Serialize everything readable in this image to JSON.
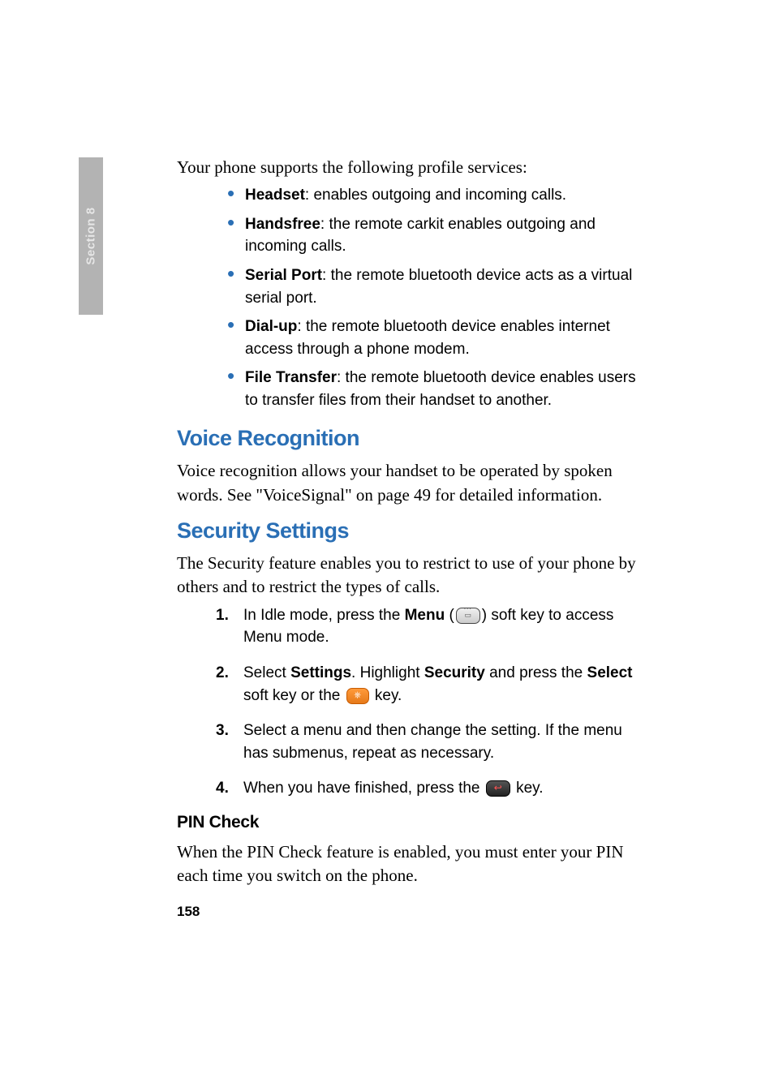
{
  "sideTab": "Section 8",
  "introProfiles": "Your phone supports the following profile services:",
  "profiles": [
    {
      "term": "Headset",
      "desc": ": enables outgoing and incoming calls."
    },
    {
      "term": "Handsfree",
      "desc": ": the remote carkit enables outgoing and incoming calls."
    },
    {
      "term": "Serial Port",
      "desc": ": the remote bluetooth device acts as a virtual serial port."
    },
    {
      "term": "Dial-up",
      "desc": ": the remote bluetooth device enables internet access through a phone modem."
    },
    {
      "term": "File Transfer",
      "desc": ": the remote bluetooth device enables users to transfer files from their handset to another."
    }
  ],
  "voiceRecognition": {
    "heading": "Voice Recognition",
    "body": "Voice recognition allows your handset to be operated by spoken words. See \"VoiceSignal\" on page 49 for detailed information."
  },
  "securitySettings": {
    "heading": "Security Settings",
    "intro": "The Security feature enables you to restrict to use of your phone by others and to restrict the types of calls.",
    "steps": {
      "s1_pre": "In Idle mode, press the ",
      "s1_menu": "Menu",
      "s1_mid": " (",
      "s1_post": ") soft key to access Menu mode.",
      "s2_pre": "Select ",
      "s2_settings": "Settings",
      "s2_mid1": ". Highlight ",
      "s2_security": "Security",
      "s2_mid2": " and press the ",
      "s2_select": "Select",
      "s2_mid3": " soft key or the ",
      "s2_post": " key.",
      "s3": "Select a menu and then change the setting. If the menu has submenus, repeat as necessary.",
      "s4_pre": "When you have finished, press the ",
      "s4_post": " key."
    },
    "numbers": [
      "1.",
      "2.",
      "3.",
      "4."
    ]
  },
  "pinCheck": {
    "heading": "PIN Check",
    "body": "When the PIN Check feature is enabled, you must enter your PIN each time you switch on the phone."
  },
  "pageNumber": "158"
}
